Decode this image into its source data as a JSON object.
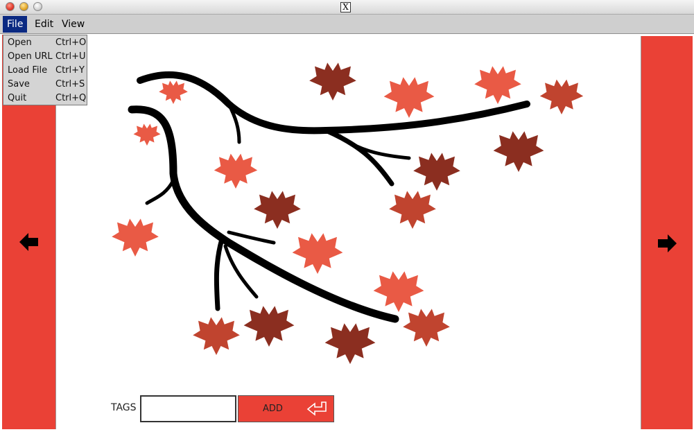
{
  "window": {
    "title_icon": "x11-icon"
  },
  "menubar": {
    "items": [
      {
        "label": "File",
        "active": true
      },
      {
        "label": "Edit"
      },
      {
        "label": "View"
      }
    ]
  },
  "file_menu": [
    {
      "label": "Open",
      "shortcut": "Ctrl+O"
    },
    {
      "label": "Open URL",
      "shortcut": "Ctrl+U"
    },
    {
      "label": "Load File",
      "shortcut": "Ctrl+Y"
    },
    {
      "label": "Save",
      "shortcut": "Ctrl+S"
    },
    {
      "label": "Quit",
      "shortcut": "Ctrl+Q"
    }
  ],
  "navigation": {
    "prev_icon": "arrow-left-icon",
    "next_icon": "arrow-right-icon"
  },
  "image": {
    "subject": "maple-branch-illustration"
  },
  "tags": {
    "label": "TAGS",
    "value": "",
    "add_label": "ADD",
    "add_icon": "enter-arrow-icon"
  },
  "colors": {
    "accent": "#ea4136",
    "leaf_light": "#e95a45",
    "leaf_mid": "#c0442f",
    "leaf_dark": "#8b2e20",
    "menu_active": "#0b2a82"
  }
}
